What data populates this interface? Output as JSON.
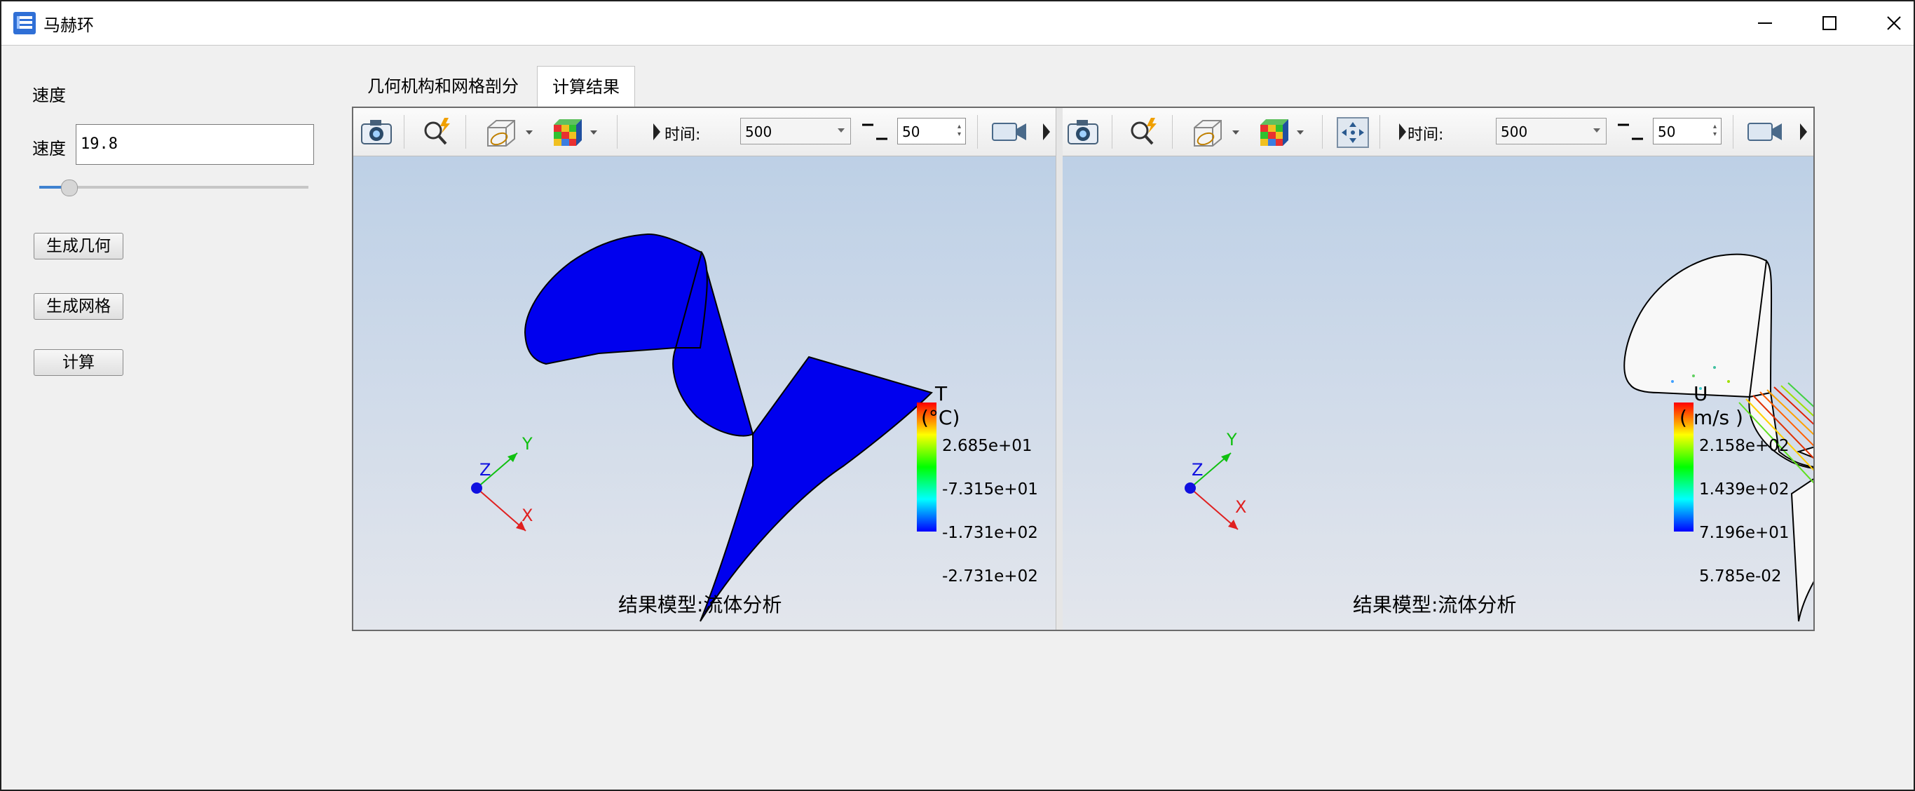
{
  "window": {
    "title": "马赫环"
  },
  "left_panel": {
    "section_label": "速度",
    "speed_label": "速度",
    "speed_value": "19.8",
    "slider_fraction": 0.11,
    "buttons": {
      "gen_geometry": "生成几何",
      "gen_mesh": "生成网格",
      "compute": "计算"
    }
  },
  "tabs": [
    {
      "label": "几何机构和网格剖分",
      "active": false
    },
    {
      "label": "计算结果",
      "active": true
    }
  ],
  "views": [
    {
      "toolbar": {
        "time_label": "时间:",
        "time_value": "500",
        "step_value": "50"
      },
      "caption": "结果模型:流体分析",
      "legend": {
        "title": "T",
        "unit": "(°C)",
        "values": [
          "2.685e+01",
          "-7.315e+01",
          "-1.731e+02",
          "-2.731e+02"
        ]
      },
      "axes": {
        "x": "X",
        "y": "Y",
        "z": "Z"
      }
    },
    {
      "toolbar": {
        "time_label": "时间:",
        "time_value": "500",
        "step_value": "50"
      },
      "caption": "结果模型:流体分析",
      "legend": {
        "title": "U",
        "unit": "( m/s )",
        "values": [
          "2.158e+02",
          "1.439e+02",
          "7.196e+01",
          "5.785e-02"
        ]
      },
      "axes": {
        "x": "X",
        "y": "Y",
        "z": "Z"
      }
    }
  ],
  "icons": [
    "app-icon",
    "minimize-icon",
    "maximize-icon",
    "close-icon",
    "camera-icon",
    "zoom-fit-icon",
    "display-mode-icon",
    "color-cube-icon",
    "pan-icon",
    "record-video-icon",
    "toolbar-grip-icon"
  ],
  "colors": {
    "solid_blue": "#0000ee",
    "accent": "#3f82d0"
  }
}
